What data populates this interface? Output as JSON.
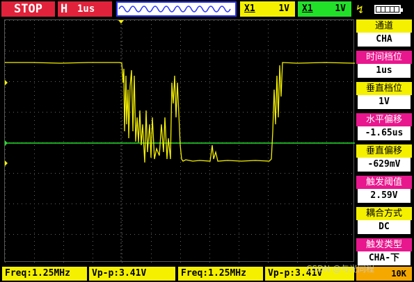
{
  "topbar": {
    "status": "STOP",
    "timebase_letter": "H",
    "timebase_value": "1us",
    "ch1_label": "X1",
    "ch1_value": "1V",
    "ch2_label": "X1",
    "ch2_value": "1V",
    "trigger_icon": "trigger-edge-icon",
    "battery_icon": "battery-icon"
  },
  "panel": {
    "items": [
      {
        "label": "通道",
        "value": "CHA",
        "style": "yellow"
      },
      {
        "label": "时间档位",
        "value": "1us",
        "style": "magenta"
      },
      {
        "label": "垂直档位",
        "value": "1V",
        "style": "yellow"
      },
      {
        "label": "水平偏移",
        "value": "-1.65us",
        "style": "magenta"
      },
      {
        "label": "垂直偏移",
        "value": "-629mV",
        "style": "yellow"
      },
      {
        "label": "触发阈值",
        "value": "2.59V",
        "style": "magenta"
      },
      {
        "label": "耦合方式",
        "value": "DC",
        "style": "yellow"
      },
      {
        "label": "触发类型",
        "value": "CHA-下",
        "style": "magenta"
      }
    ]
  },
  "measurements": [
    {
      "text": "Freq:1.25MHz"
    },
    {
      "text": "Vp-p:3.41V"
    },
    {
      "text": "Freq:1.25MHz"
    },
    {
      "text": "Vp-p:3.41V"
    }
  ],
  "bottom_right": "10K",
  "watermark": "CSDN @与光同程",
  "colors": {
    "ch1": "#f5f000",
    "ch2": "#22e02a",
    "accent_red": "#e0233a",
    "magenta": "#e8178d"
  }
}
